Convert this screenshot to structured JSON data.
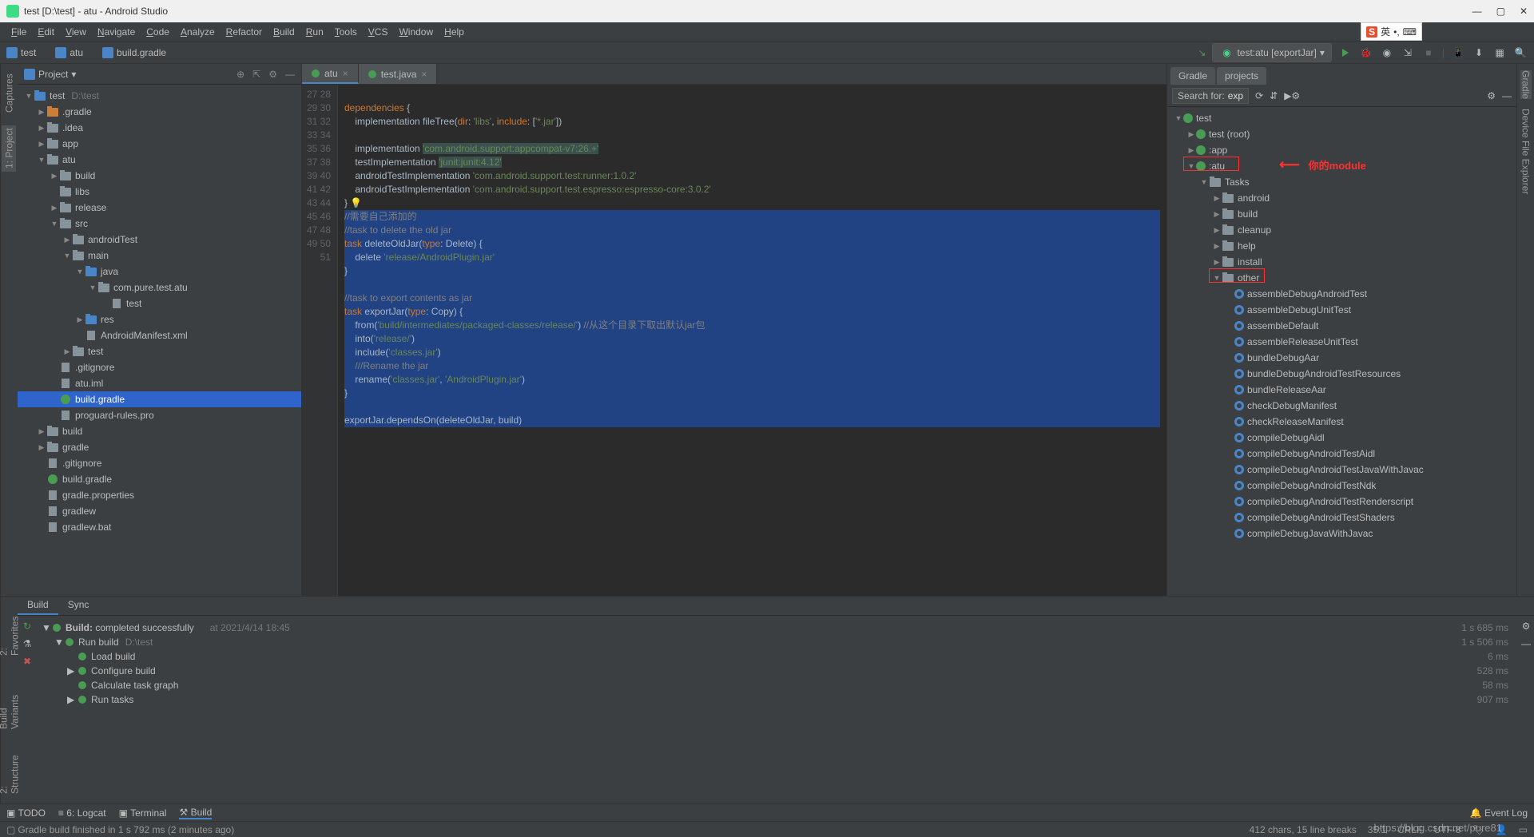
{
  "title": "test [D:\\test] - atu - Android Studio",
  "menus": [
    "File",
    "Edit",
    "View",
    "Navigate",
    "Code",
    "Analyze",
    "Refactor",
    "Build",
    "Run",
    "Tools",
    "VCS",
    "Window",
    "Help"
  ],
  "breadcrumbs": [
    {
      "icon": "test",
      "label": "test"
    },
    {
      "icon": "atu",
      "label": "atu"
    },
    {
      "icon": "gradle",
      "label": "build.gradle"
    }
  ],
  "run_config": "test:atu [exportJar]",
  "left_tabs": [
    "1: Project",
    "Captures"
  ],
  "right_tabs": [
    "Gradle",
    "Device File Explorer"
  ],
  "bottom_left_tabs": [
    "2: Structure",
    "Build Variants",
    "2: Favorites"
  ],
  "project_panel": {
    "title": "Project",
    "chev": "▾"
  },
  "project_tree": [
    {
      "d": 0,
      "a": "▼",
      "i": "test",
      "t": "test",
      "hint": "D:\\test"
    },
    {
      "d": 1,
      "a": "▶",
      "i": "folder orange",
      "t": ".gradle"
    },
    {
      "d": 1,
      "a": "▶",
      "i": "folder",
      "t": ".idea"
    },
    {
      "d": 1,
      "a": "▶",
      "i": "folder",
      "t": "app"
    },
    {
      "d": 1,
      "a": "▼",
      "i": "folder",
      "t": "atu"
    },
    {
      "d": 2,
      "a": "▶",
      "i": "folder",
      "t": "build"
    },
    {
      "d": 2,
      "a": "",
      "i": "folder",
      "t": "libs"
    },
    {
      "d": 2,
      "a": "▶",
      "i": "folder",
      "t": "release"
    },
    {
      "d": 2,
      "a": "▼",
      "i": "folder",
      "t": "src"
    },
    {
      "d": 3,
      "a": "▶",
      "i": "folder",
      "t": "androidTest"
    },
    {
      "d": 3,
      "a": "▼",
      "i": "folder",
      "t": "main"
    },
    {
      "d": 4,
      "a": "▼",
      "i": "folder blue",
      "t": "java"
    },
    {
      "d": 5,
      "a": "▼",
      "i": "folder",
      "t": "com.pure.test.atu"
    },
    {
      "d": 6,
      "a": "",
      "i": "cfile",
      "t": "test"
    },
    {
      "d": 4,
      "a": "▶",
      "i": "folder blue",
      "t": "res"
    },
    {
      "d": 4,
      "a": "",
      "i": "xfile",
      "t": "AndroidManifest.xml"
    },
    {
      "d": 3,
      "a": "▶",
      "i": "folder",
      "t": "test"
    },
    {
      "d": 2,
      "a": "",
      "i": "file",
      "t": ".gitignore"
    },
    {
      "d": 2,
      "a": "",
      "i": "file",
      "t": "atu.iml"
    },
    {
      "d": 2,
      "a": "",
      "i": "gfile",
      "t": "build.gradle",
      "sel": true
    },
    {
      "d": 2,
      "a": "",
      "i": "file",
      "t": "proguard-rules.pro"
    },
    {
      "d": 1,
      "a": "▶",
      "i": "folder",
      "t": "build"
    },
    {
      "d": 1,
      "a": "▶",
      "i": "folder",
      "t": "gradle"
    },
    {
      "d": 1,
      "a": "",
      "i": "file",
      "t": ".gitignore"
    },
    {
      "d": 1,
      "a": "",
      "i": "gfile",
      "t": "build.gradle"
    },
    {
      "d": 1,
      "a": "",
      "i": "file",
      "t": "gradle.properties"
    },
    {
      "d": 1,
      "a": "",
      "i": "file",
      "t": "gradlew"
    },
    {
      "d": 1,
      "a": "",
      "i": "file",
      "t": "gradlew.bat"
    }
  ],
  "editor_tabs": [
    {
      "label": "atu",
      "active": true
    },
    {
      "label": "test.java",
      "active": false
    }
  ],
  "code": {
    "start": 27,
    "lines": [
      {
        "n": 27,
        "h": ""
      },
      {
        "n": 28,
        "h": "<span class='kw'>dependencies</span> {"
      },
      {
        "n": 29,
        "h": "    implementation fileTree(<span class='kw'>dir</span>: <span class='str'>'libs'</span>, <span class='kw'>include</span>: [<span class='str'>'*.jar'</span>])"
      },
      {
        "n": 30,
        "h": ""
      },
      {
        "n": 31,
        "h": "    implementation <span class='str hl'>'com.android.support:appcompat-v7:26.+'</span>"
      },
      {
        "n": 32,
        "h": "    testImplementation <span class='str hl'>'junit:junit:4.12'</span>"
      },
      {
        "n": 33,
        "h": "    androidTestImplementation <span class='str'>'com.android.support.test:runner:1.0.2'</span>"
      },
      {
        "n": 34,
        "h": "    androidTestImplementation <span class='str'>'com.android.support.test.espresso:espresso-core:3.0.2'</span>"
      },
      {
        "n": 35,
        "h": "} 💡",
        "sel": false
      },
      {
        "n": 36,
        "h": "<span class='cmt'>//需要自己添加的</span>",
        "sel": true
      },
      {
        "n": 37,
        "h": "<span class='cmt'>//task to delete the old jar</span>",
        "sel": true
      },
      {
        "n": 38,
        "h": "<span class='kw'>task</span> deleteOldJar(<span class='kw'>type</span>: Delete) {",
        "sel": true
      },
      {
        "n": 39,
        "h": "    delete <span class='str'>'release/AndroidPlugin.jar'</span>",
        "sel": true
      },
      {
        "n": 40,
        "h": "}",
        "sel": true
      },
      {
        "n": 41,
        "h": "",
        "sel": true
      },
      {
        "n": 42,
        "h": "<span class='cmt'>//task to export contents as jar</span>",
        "sel": true
      },
      {
        "n": 43,
        "h": "<span class='kw'>task</span> exportJar(<span class='kw'>type</span>: Copy) {",
        "sel": true
      },
      {
        "n": 44,
        "h": "    from(<span class='str'>'build/intermediates/packaged-classes/release/'</span>) <span class='cmt'>//从这个目录下取出默认jar包</span>",
        "sel": true
      },
      {
        "n": 45,
        "h": "    into(<span class='str'>'release/'</span>)",
        "sel": true
      },
      {
        "n": 46,
        "h": "    include(<span class='str'>'classes.jar'</span>)",
        "sel": true
      },
      {
        "n": 47,
        "h": "    <span class='cmt'>///Rename the jar</span>",
        "sel": true
      },
      {
        "n": 48,
        "h": "    rename(<span class='str'>'classes.jar'</span>, <span class='str'>'AndroidPlugin.jar'</span>)",
        "sel": true
      },
      {
        "n": 49,
        "h": "}",
        "sel": true
      },
      {
        "n": 50,
        "h": "",
        "sel": true
      },
      {
        "n": 51,
        "h": "exportJar.dependsOn(deleteOldJar, build)",
        "sel": true
      }
    ]
  },
  "gradle": {
    "tabs": [
      "Gradle",
      "projects"
    ],
    "search_label": "Search for:",
    "search_value": "exp",
    "tree": [
      {
        "d": 0,
        "a": "▼",
        "i": "g",
        "t": "test"
      },
      {
        "d": 1,
        "a": "▶",
        "i": "g",
        "t": "test (root)"
      },
      {
        "d": 1,
        "a": "▶",
        "i": "g",
        "t": ":app"
      },
      {
        "d": 1,
        "a": "▼",
        "i": "g",
        "t": ":atu",
        "box": true
      },
      {
        "d": 2,
        "a": "▼",
        "i": "folder",
        "t": "Tasks"
      },
      {
        "d": 3,
        "a": "▶",
        "i": "folder",
        "t": "android"
      },
      {
        "d": 3,
        "a": "▶",
        "i": "folder",
        "t": "build"
      },
      {
        "d": 3,
        "a": "▶",
        "i": "folder",
        "t": "cleanup"
      },
      {
        "d": 3,
        "a": "▶",
        "i": "folder",
        "t": "help"
      },
      {
        "d": 3,
        "a": "▶",
        "i": "folder",
        "t": "install"
      },
      {
        "d": 3,
        "a": "▼",
        "i": "folder",
        "t": "other",
        "box": true
      },
      {
        "d": 4,
        "a": "",
        "i": "t",
        "t": "assembleDebugAndroidTest"
      },
      {
        "d": 4,
        "a": "",
        "i": "t",
        "t": "assembleDebugUnitTest"
      },
      {
        "d": 4,
        "a": "",
        "i": "t",
        "t": "assembleDefault"
      },
      {
        "d": 4,
        "a": "",
        "i": "t",
        "t": "assembleReleaseUnitTest"
      },
      {
        "d": 4,
        "a": "",
        "i": "t",
        "t": "bundleDebugAar"
      },
      {
        "d": 4,
        "a": "",
        "i": "t",
        "t": "bundleDebugAndroidTestResources"
      },
      {
        "d": 4,
        "a": "",
        "i": "t",
        "t": "bundleReleaseAar"
      },
      {
        "d": 4,
        "a": "",
        "i": "t",
        "t": "checkDebugManifest"
      },
      {
        "d": 4,
        "a": "",
        "i": "t",
        "t": "checkReleaseManifest"
      },
      {
        "d": 4,
        "a": "",
        "i": "t",
        "t": "compileDebugAidl"
      },
      {
        "d": 4,
        "a": "",
        "i": "t",
        "t": "compileDebugAndroidTestAidl"
      },
      {
        "d": 4,
        "a": "",
        "i": "t",
        "t": "compileDebugAndroidTestJavaWithJavac"
      },
      {
        "d": 4,
        "a": "",
        "i": "t",
        "t": "compileDebugAndroidTestNdk"
      },
      {
        "d": 4,
        "a": "",
        "i": "t",
        "t": "compileDebugAndroidTestRenderscript"
      },
      {
        "d": 4,
        "a": "",
        "i": "t",
        "t": "compileDebugAndroidTestShaders"
      },
      {
        "d": 4,
        "a": "",
        "i": "t",
        "t": "compileDebugJavaWithJavac"
      }
    ],
    "annotation": "你的module"
  },
  "build_panel": {
    "tabs": [
      "Build",
      "Sync"
    ],
    "title": "Build:",
    "status": "completed successfully",
    "time": "at 2021/4/14 18:45",
    "rows": [
      {
        "d": 0,
        "a": "▼",
        "t": "Run build",
        "hint": "D:\\test",
        "time": "1 s 506 ms"
      },
      {
        "d": 1,
        "a": "",
        "t": "Load build",
        "time": "6 ms"
      },
      {
        "d": 1,
        "a": "▶",
        "t": "Configure build",
        "time": "528 ms"
      },
      {
        "d": 1,
        "a": "",
        "t": "Calculate task graph",
        "time": "58 ms"
      },
      {
        "d": 1,
        "a": "▶",
        "t": "Run tasks",
        "time": "907 ms"
      }
    ],
    "overall_time": "1 s 685 ms"
  },
  "toolstrip": [
    "TODO",
    "6: Logcat",
    "Terminal",
    "Build"
  ],
  "toolstrip_right": "Event Log",
  "status": {
    "msg": "Gradle build finished in 1 s 792 ms (2 minutes ago)",
    "info": "412 chars, 15 line breaks",
    "pos": "35:1",
    "crlf": "CRLF",
    "enc": "UTF-8"
  },
  "ime": {
    "badge": "S",
    "lang": "英",
    "punct": "•,",
    "kb": "⌨"
  },
  "watermark": "https://blog.csdn.net/pure81"
}
